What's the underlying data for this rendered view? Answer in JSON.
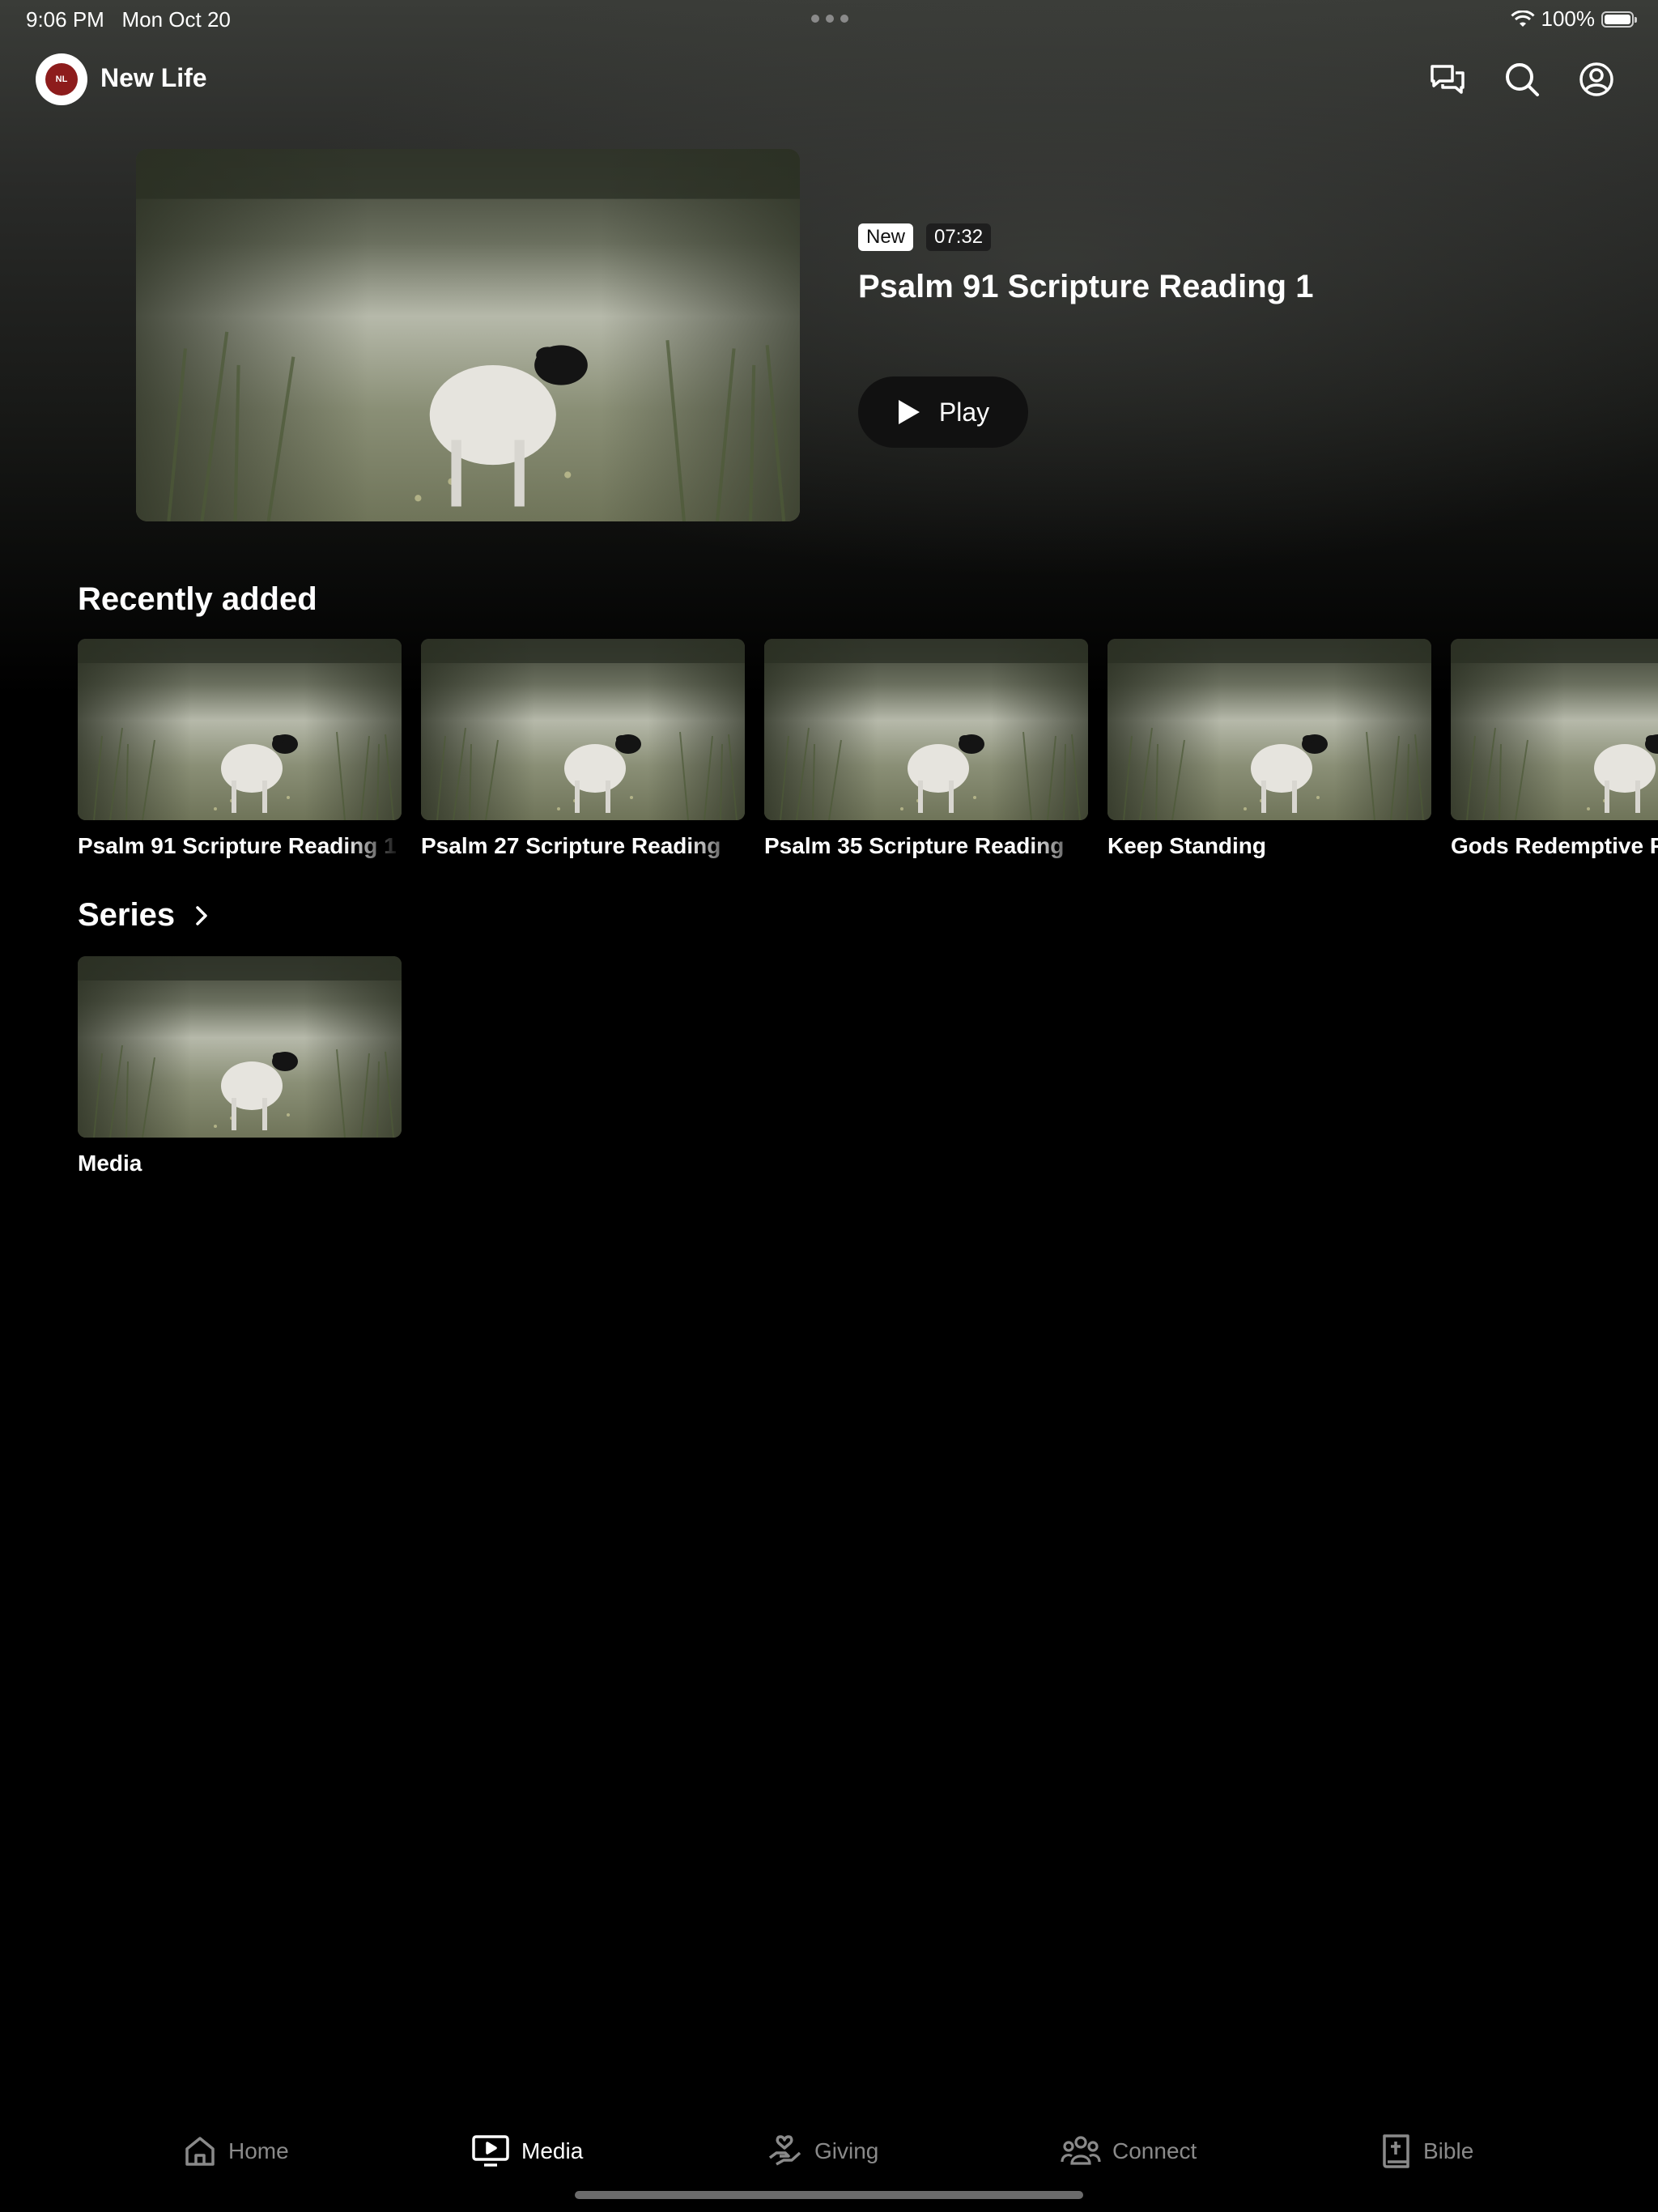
{
  "status_bar": {
    "time": "9:06 PM",
    "date": "Mon Oct 20",
    "battery": "100%"
  },
  "header": {
    "app_title": "New Life",
    "logo_text": "NL"
  },
  "hero": {
    "badge_new": "New",
    "duration": "07:32",
    "title": "Psalm 91 Scripture Reading 1",
    "play_label": "Play"
  },
  "recently_added": {
    "title": "Recently added",
    "items": [
      {
        "label": "Psalm 91 Scripture Reading 1"
      },
      {
        "label": "Psalm 27 Scripture Reading"
      },
      {
        "label": "Psalm 35 Scripture Reading"
      },
      {
        "label": "Keep Standing"
      },
      {
        "label": "Gods Redemptive Plan"
      }
    ]
  },
  "series": {
    "title": "Series",
    "items": [
      {
        "label": "Media"
      }
    ]
  },
  "tabs": [
    {
      "label": "Home",
      "icon": "home-icon",
      "active": false
    },
    {
      "label": "Media",
      "icon": "media-icon",
      "active": true
    },
    {
      "label": "Giving",
      "icon": "giving-icon",
      "active": false
    },
    {
      "label": "Connect",
      "icon": "connect-icon",
      "active": false
    },
    {
      "label": "Bible",
      "icon": "bible-icon",
      "active": false
    }
  ],
  "colors": {
    "background": "#000000",
    "inactive_tab": "#8a8a8a",
    "logo_red": "#8d1c1c"
  }
}
